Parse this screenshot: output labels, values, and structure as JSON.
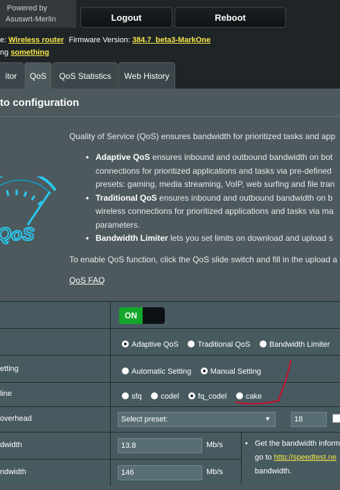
{
  "header": {
    "brand_line1": "Powered by",
    "brand_line2": "Asuswrt-Merlin",
    "logout_label": "Logout",
    "reboot_label": "Reboot",
    "mode_prefix": "e:",
    "mode_value": "Wireless router",
    "firmware_label": "Firmware Version:",
    "firmware_value": "384.7_beta3-MarkOne",
    "ssid_prefix": "ng",
    "ssid_value": "something"
  },
  "tabs": [
    {
      "label": "itor"
    },
    {
      "label": "QoS"
    },
    {
      "label": "QoS Statistics"
    },
    {
      "label": "Web History"
    }
  ],
  "page": {
    "title": "to configuration",
    "intro": "Quality of Service (QoS) ensures bandwidth for prioritized tasks and app",
    "bullets": [
      {
        "bold": "Adaptive QoS",
        "lines": [
          " ensures inbound and outbound bandwidth on bot",
          "connections for prioritized applications and tasks via pre-defined",
          "presets: gaming, media streaming, VoIP, web surfing and file tran"
        ]
      },
      {
        "bold": "Traditional QoS",
        "lines": [
          " ensures inbound and outbound bandwidth on b",
          "wireless connections for prioritized applications and tasks via ma",
          "parameters."
        ]
      },
      {
        "bold": "Bandwidth Limiter",
        "lines": [
          " lets you set limits on download and upload s"
        ]
      }
    ],
    "enable_text": "To enable QoS function, click the QoS slide switch and fill in the upload a",
    "faq_link": "QoS FAQ",
    "logo_text": "QoS"
  },
  "settings": {
    "toggle_label": "ON",
    "qos_types": [
      "Adaptive QoS",
      "Traditional QoS",
      "Bandwidth Limiter"
    ],
    "bw_setting_label": "etting",
    "bw_setting_options": [
      "Automatic Setting",
      "Manual Setting"
    ],
    "discipline_label": "line",
    "discipline_options": [
      "sfq",
      "codel",
      "fq_codel",
      "cake"
    ],
    "overhead_label": "overhead",
    "overhead_preset": "Select preset:",
    "overhead_value": "18",
    "upload_label": "dwidth",
    "upload_value": "13.8",
    "upload_unit": "Mb/s",
    "download_label": "ndwidth",
    "download_value": "146",
    "download_unit": "Mb/s",
    "hint_line1": "Get the bandwidth inform",
    "hint_prefix": "go to",
    "hint_link": "http://speedtest.ne",
    "hint_line3": "bandwidth."
  },
  "colors": {
    "background": "#1f2427",
    "panel": "#4d595d",
    "accent_yellow": "#f5e84a",
    "toggle_on": "#13a82b",
    "annotation_red": "#c8102e"
  }
}
